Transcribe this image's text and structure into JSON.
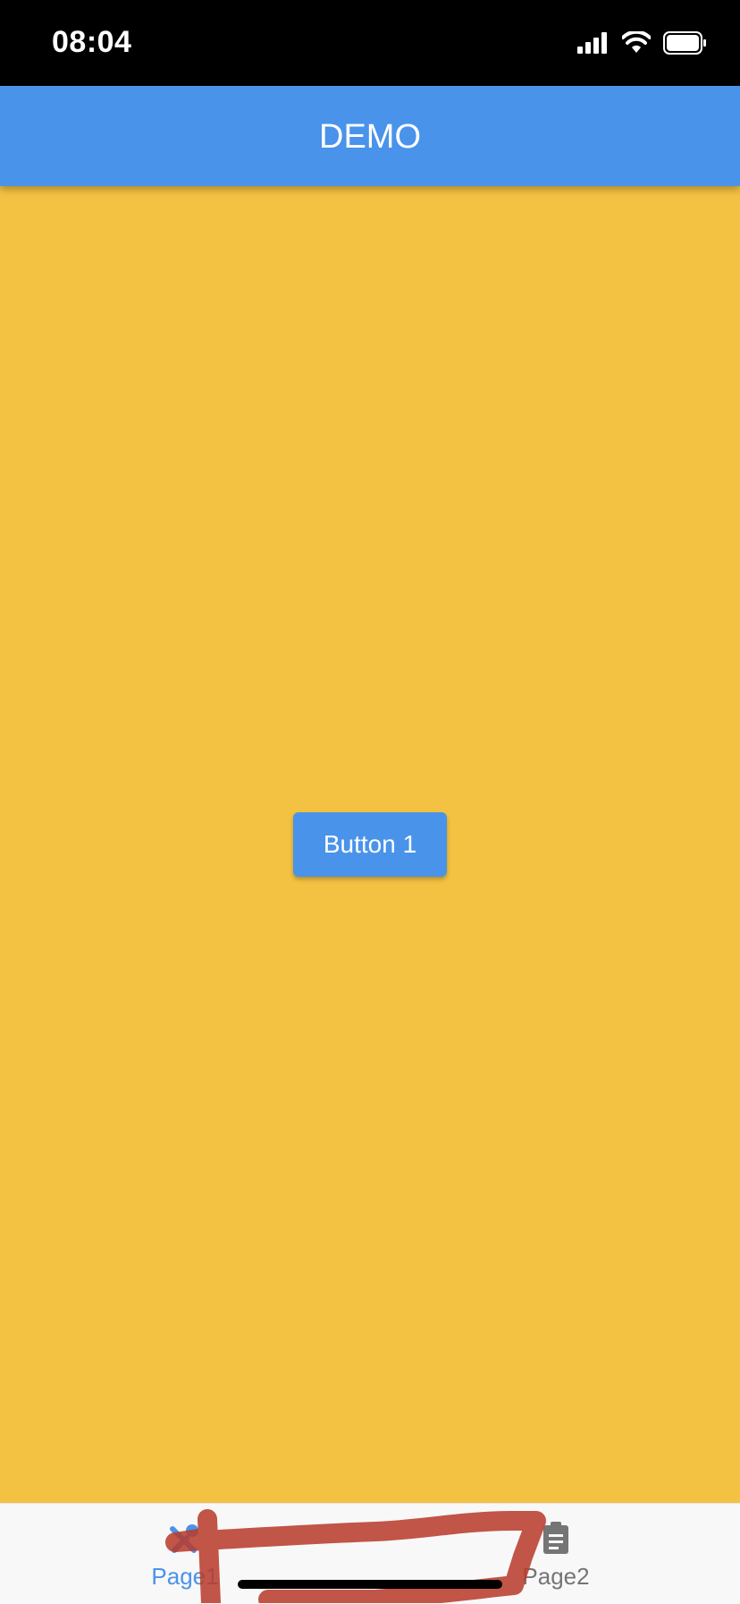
{
  "status_bar": {
    "time": "08:04",
    "icons": [
      "cellular-signal-icon",
      "wifi-icon",
      "battery-icon"
    ]
  },
  "app_bar": {
    "title": "DEMO",
    "background_color": "#4A93EA"
  },
  "content": {
    "background_color": "#F3C242",
    "button_label": "Button 1"
  },
  "bottom_nav": {
    "items": [
      {
        "label": "Page1",
        "icon": "pen-icon",
        "active": true
      },
      {
        "label": "Page2",
        "icon": "clipboard-icon",
        "active": false
      }
    ],
    "active_color": "#4A93EA",
    "inactive_color": "#757575"
  },
  "annotation": {
    "color": "#B83A2A",
    "icon": "red-freehand-annotation"
  }
}
